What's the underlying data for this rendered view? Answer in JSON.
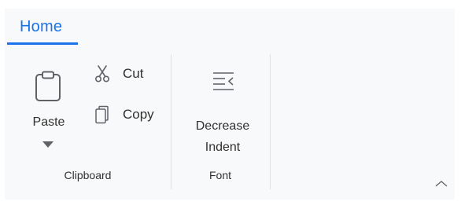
{
  "ribbon": {
    "tabs": [
      {
        "label": "Home",
        "active": true
      }
    ],
    "groups": [
      {
        "label": "Clipboard",
        "paste": {
          "label": "Paste",
          "icon": "clipboard-icon"
        },
        "cut": {
          "label": "Cut",
          "icon": "scissors-icon"
        },
        "copy": {
          "label": "Copy",
          "icon": "copy-icon"
        }
      },
      {
        "label": "Font",
        "decrease_indent": {
          "line1": "Decrease",
          "line2": "Indent",
          "icon": "decrease-indent-icon"
        }
      }
    ],
    "collapse_icon": "chevron-up-icon"
  },
  "colors": {
    "accent": "#1a73e8",
    "ribbon_background": "#f8f9fa",
    "text": "#323130",
    "icon": "#5f6368",
    "separator": "#e1e1e1"
  }
}
